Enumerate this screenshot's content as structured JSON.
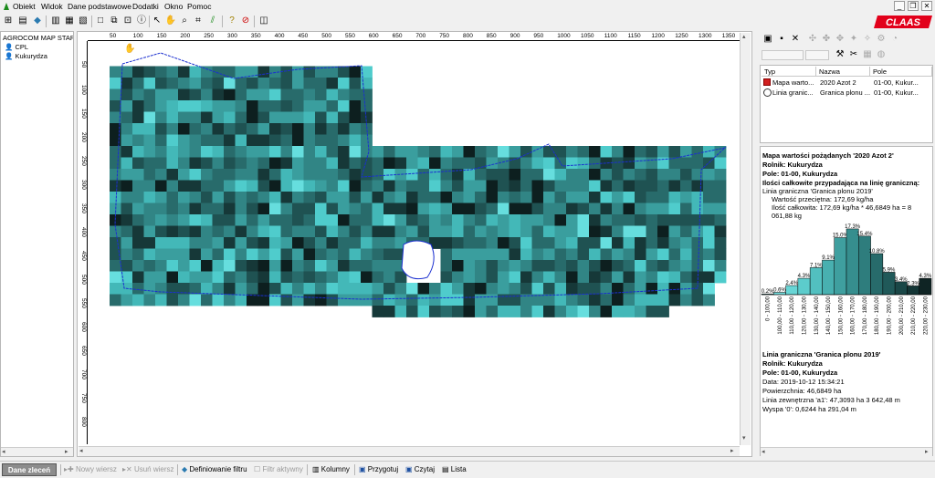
{
  "menu": [
    "Obiekt",
    "Widok",
    "Dane podstawowe",
    "Dodatki",
    "Okno",
    "Pomoc"
  ],
  "brand": {
    "logo_text": "CLAAS",
    "color": "#e2001a"
  },
  "tree": {
    "root": "AGROCOM MAP STAR",
    "items": [
      {
        "label": "CPL",
        "icon": "person-icon"
      },
      {
        "label": "Kukurydza",
        "icon": "person-icon"
      }
    ]
  },
  "ruler": {
    "top": [
      "50",
      "100",
      "150",
      "200",
      "250",
      "300",
      "350",
      "400",
      "450",
      "500",
      "550",
      "600",
      "650",
      "700",
      "750",
      "800",
      "850",
      "900",
      "950",
      "1000",
      "1050",
      "1100",
      "1150",
      "1200",
      "1250",
      "1300",
      "1350"
    ],
    "left": [
      "50",
      "100",
      "150",
      "200",
      "250",
      "300",
      "350",
      "400",
      "450",
      "500",
      "550",
      "600",
      "650",
      "700",
      "750",
      "800"
    ]
  },
  "layers_table": {
    "headers": [
      "Typ",
      "Nazwa",
      "Pole"
    ],
    "rows": [
      {
        "type": "Mapa warto...",
        "name": "2020 Azot 2",
        "field": "01-00, Kukur..."
      },
      {
        "type": "Linia granic...",
        "name": "Granica plonu ...",
        "field": "01-00, Kukur..."
      }
    ]
  },
  "info_map": {
    "title": "Mapa wartości pożądanych '2020 Azot 2'",
    "farmer": "Rolnik: Kukurydza",
    "field": "Pole: 01-00, Kukurydza",
    "boundary_title": "Ilości całkowite przypadająca na linię graniczną:",
    "boundary_name": "Linia graniczna 'Granica plonu 2019'",
    "avg": "Wartość przeciętna: 172,69 kg/ha",
    "total_1": "Ilość całkowita: 172,69 kg/ha * 46,6849 ha = 8",
    "total_2": "061,88 kg"
  },
  "chart_data": {
    "type": "bar",
    "categories": [
      "0 - 100,00",
      "100,00 - 110,00",
      "110,00 - 120,00",
      "120,00 - 130,00",
      "130,00 - 140,00",
      "140,00 - 150,00",
      "150,00 - 160,00",
      "160,00 - 170,00",
      "170,00 - 180,00",
      "180,00 - 190,00",
      "190,00 - 200,00",
      "200,00 - 210,00",
      "210,00 - 220,00",
      "220,00 - 230,00"
    ],
    "tick_labels": [
      "0 - 100,00",
      "100,00 - 110,00",
      "110,00 - 120,00",
      "120,00 - 130,00",
      "130,00 - 140,00",
      "140,00 - 150,00",
      "150,00 - 160,00",
      "160,00 - 170,00",
      "170,00 - 180,00",
      "180,00 - 190,00",
      "190,00 - 200,00",
      "200,00 - 210,00",
      "210,00 - 220,00",
      "220,00 - 230,00"
    ],
    "values": [
      0.2,
      0.6,
      2.4,
      4.3,
      7.1,
      9.1,
      15.0,
      17.3,
      15.4,
      10.8,
      5.9,
      3.4,
      2.3,
      4.3
    ],
    "labels": [
      "0.2%",
      "0.6%",
      "2.4%",
      "4.3%",
      "7.1%",
      "9.1%",
      "15.0%",
      "17.3%",
      "15.4%",
      "10.8%",
      "5.9%",
      "3.4%",
      "2.3%",
      "4.3%"
    ],
    "colors": [
      "#7fe6e6",
      "#73dede",
      "#68d5d5",
      "#5ccccc",
      "#52c0c0",
      "#48b0b0",
      "#3f9f9f",
      "#368e8e",
      "#2e7d7d",
      "#276b6b",
      "#205959",
      "#1a4747",
      "#143636",
      "#0f2424"
    ],
    "ylim": [
      0,
      18
    ]
  },
  "info_boundary": {
    "title": "Linia graniczna 'Granica plonu 2019'",
    "farmer": "Rolnik: Kukurydza",
    "field": "Pole: 01-00, Kukurydza",
    "date": "Data: 2019-10-12 15:34:21",
    "area": "Powierzchnia: 46,6849 ha",
    "outer": "Linia zewnętrzna 'a1': 47,3093 ha    3 642,48 m",
    "island": "Wyspa '0': 0,6244 ha    291,04 m"
  },
  "bottom": {
    "orders": "Dane zleceń",
    "new_row": "Nowy wiersz",
    "delete_row": "Usuń wiersz",
    "filter_def": "Definiowanie filtru",
    "filter_active": "Filtr aktywny",
    "columns": "Kolumny",
    "prepare": "Przygotuj",
    "read": "Czytaj",
    "list": "Lista"
  },
  "map_colors": [
    "#0d1f1f",
    "#163838",
    "#1f5252",
    "#286b6b",
    "#318585",
    "#3a9e9e",
    "#43b8b8",
    "#4fcccc",
    "#66dede"
  ]
}
